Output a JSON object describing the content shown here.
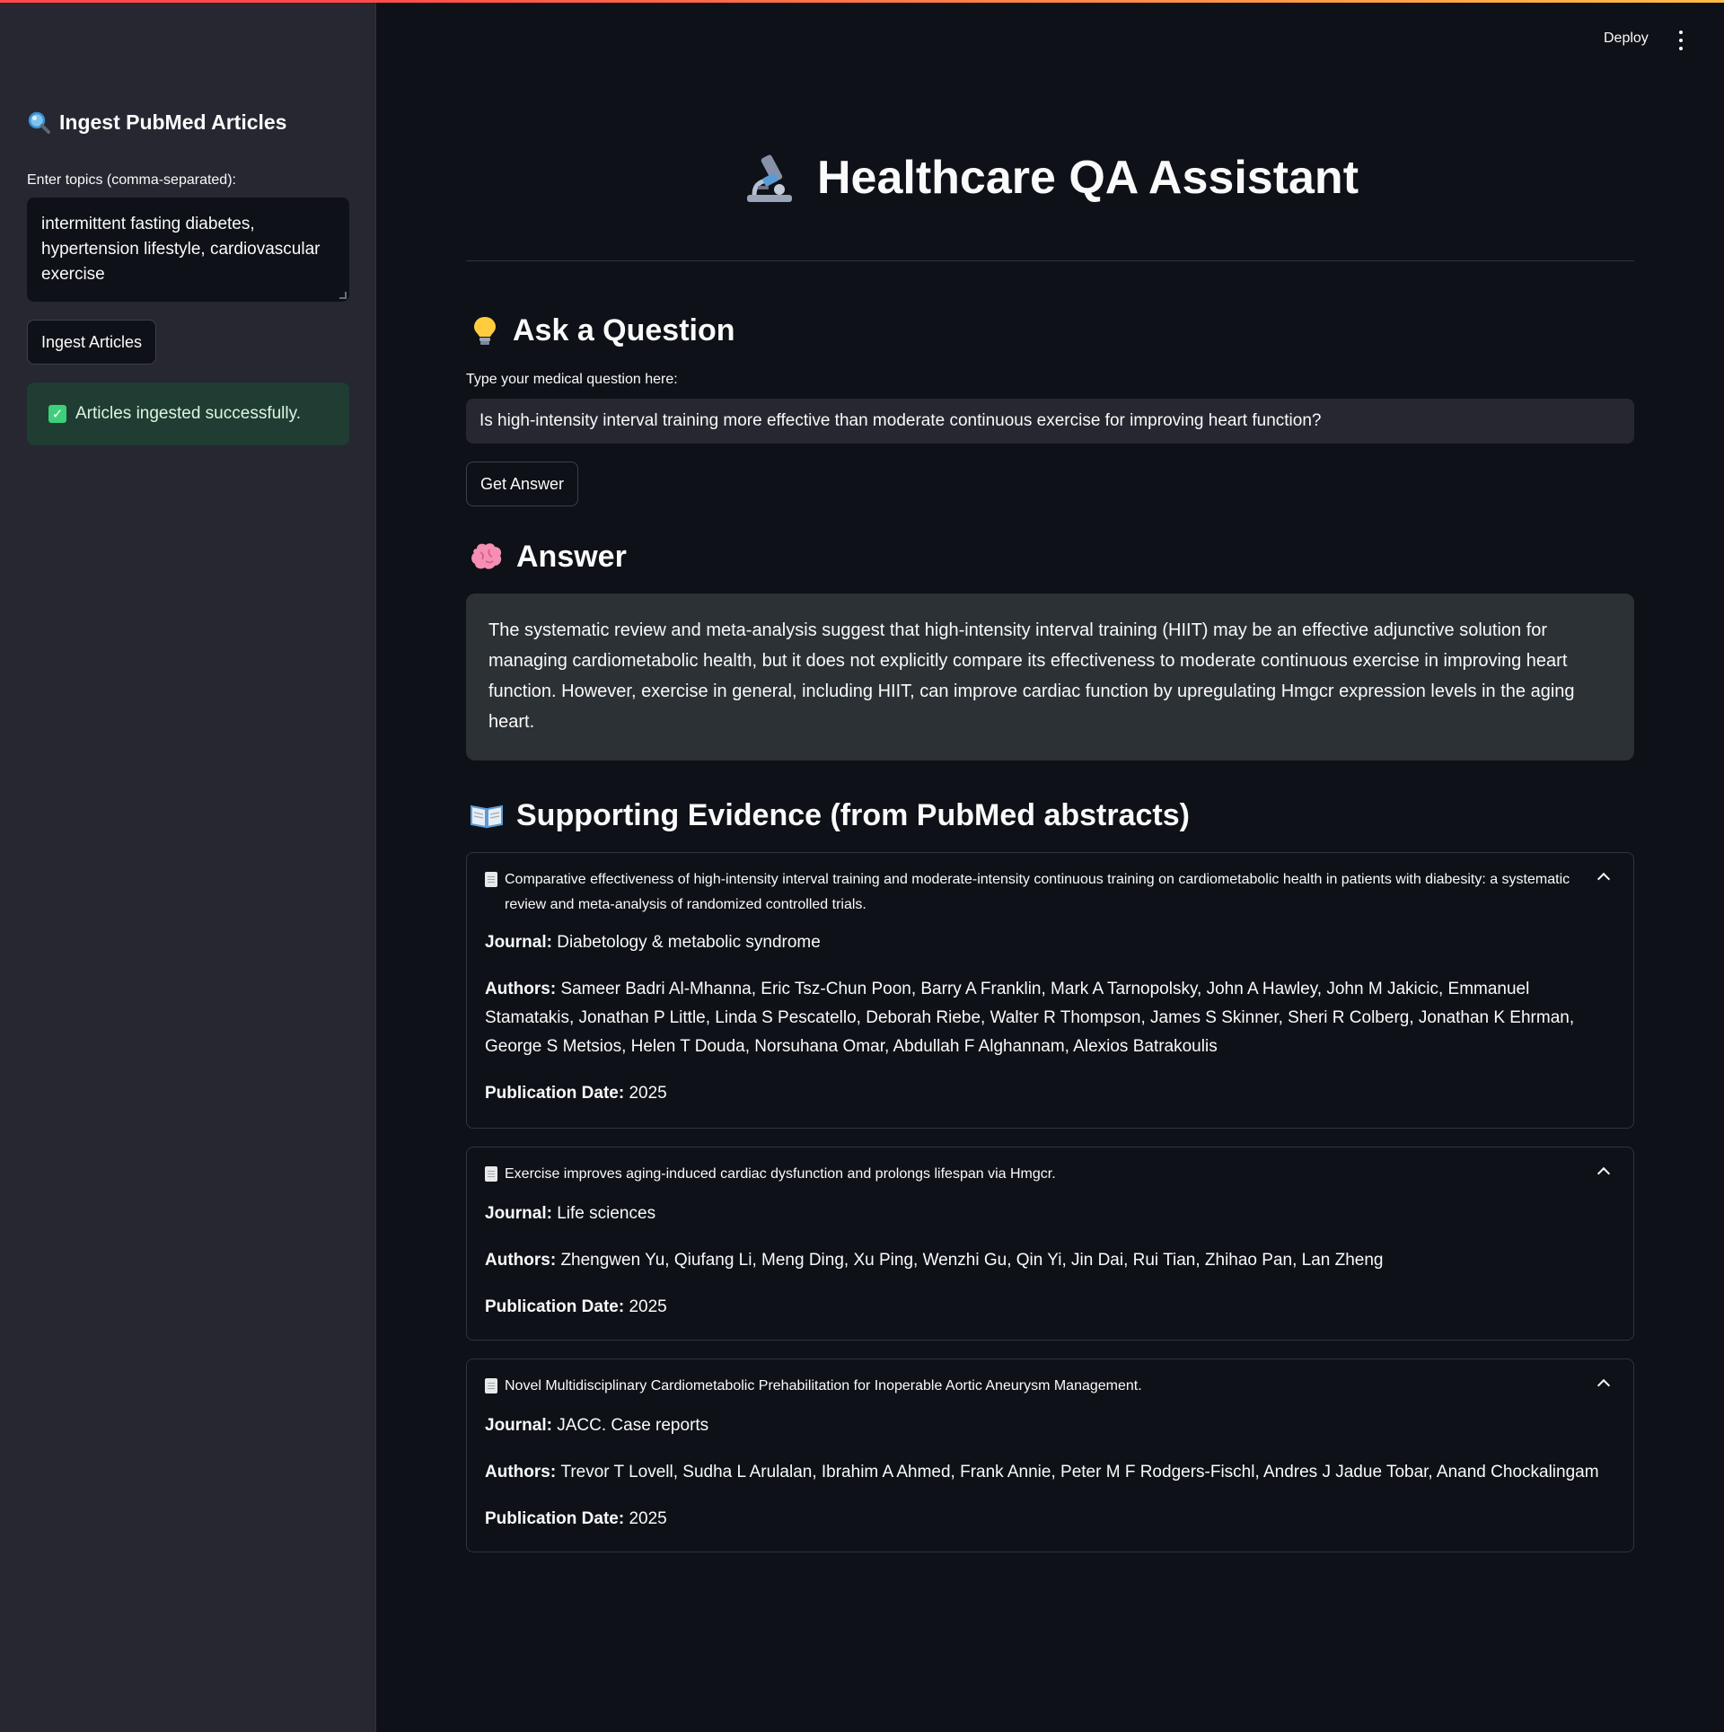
{
  "sidebar": {
    "heading": "Ingest PubMed Articles",
    "topics_label": "Enter topics (comma-separated):",
    "topics_value": "intermittent fasting diabetes, hypertension lifestyle, cardiovascular exercise",
    "ingest_button": "Ingest Articles",
    "success_message": "Articles ingested successfully."
  },
  "header": {
    "deploy_label": "Deploy",
    "menu_icon": "more-vertical-icon"
  },
  "main": {
    "title": "Healthcare QA Assistant",
    "ask_heading": "Ask a Question",
    "question_label": "Type your medical question here:",
    "question_value": "Is high-intensity interval training more effective than moderate continuous exercise for improving heart function?",
    "get_answer_button": "Get Answer",
    "answer_heading": "Answer",
    "answer_text": "The systematic review and meta-analysis suggest that high-intensity interval training (HIIT) may be an effective adjunctive solution for managing cardiometabolic health, but it does not explicitly compare its effectiveness to moderate continuous exercise in improving heart function. However, exercise in general, including HIIT, can improve cardiac function by upregulating Hmgcr expression levels in the aging heart.",
    "evidence_heading": "Supporting Evidence (from PubMed abstracts)",
    "labels": {
      "journal": "Journal:",
      "authors": "Authors:",
      "pub_date": "Publication Date:"
    },
    "evidence": [
      {
        "title": "Comparative effectiveness of high-intensity interval training and moderate-intensity continuous training on cardiometabolic health in patients with diabesity: a systematic review and meta-analysis of randomized controlled trials.",
        "journal": "Diabetology & metabolic syndrome",
        "authors": "Sameer Badri Al-Mhanna, Eric Tsz-Chun Poon, Barry A Franklin, Mark A Tarnopolsky, John A Hawley, John M Jakicic, Emmanuel Stamatakis, Jonathan P Little, Linda S Pescatello, Deborah Riebe, Walter R Thompson, James S Skinner, Sheri R Colberg, Jonathan K Ehrman, George S Metsios, Helen T Douda, Norsuhana Omar, Abdullah F Alghannam, Alexios Batrakoulis",
        "date": "2025"
      },
      {
        "title": "Exercise improves aging-induced cardiac dysfunction and prolongs lifespan via Hmgcr.",
        "journal": "Life sciences",
        "authors": "Zhengwen Yu, Qiufang Li, Meng Ding, Xu Ping, Wenzhi Gu, Qin Yi, Jin Dai, Rui Tian, Zhihao Pan, Lan Zheng",
        "date": "2025"
      },
      {
        "title": "Novel Multidisciplinary Cardiometabolic Prehabilitation for Inoperable Aortic Aneurysm Management.",
        "journal": "JACC. Case reports",
        "authors": "Trevor T Lovell, Sudha L Arulalan, Ibrahim A Ahmed, Frank Annie, Peter M F Rodgers-Fischl, Andres J Jadue Tobar, Anand Chockalingam",
        "date": "2025"
      }
    ]
  },
  "colors": {
    "background": "#0e1117",
    "sidebar": "#262730",
    "success_bg": "#1f3d32",
    "answer_bg": "#2c3135",
    "accent_stripe": "#ff4b4b"
  }
}
